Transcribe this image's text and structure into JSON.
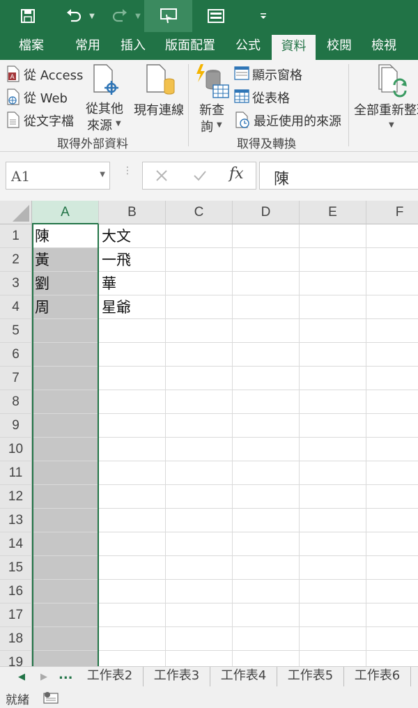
{
  "qat": {
    "save_icon": "save-icon",
    "undo_icon": "undo-icon",
    "redo_icon": "redo-icon",
    "touch_icon": "touch-mode-icon",
    "form_icon": "form-icon",
    "customize_icon": "customize-qat-icon"
  },
  "tabs": [
    "檔案",
    "常用",
    "插入",
    "版面配置",
    "公式",
    "資料",
    "校閱",
    "檢視"
  ],
  "active_tab": "資料",
  "ribbon": {
    "from_access": "從 Access",
    "from_web": "從 Web",
    "from_text": "從文字檔",
    "from_other_1": "從其他",
    "from_other_2": "來源",
    "existing_connections": "現有連線",
    "group1_label": "取得外部資料",
    "new_query_1": "新查",
    "new_query_2": "詢",
    "show_queries": "顯示窗格",
    "from_table": "從表格",
    "recent_sources": "最近使用的來源",
    "group2_label": "取得及轉換",
    "refresh_all": "全部重新整理"
  },
  "formula_bar": {
    "name_box": "A1",
    "formula": "陳"
  },
  "columns": [
    "A",
    "B",
    "C",
    "D",
    "E",
    "F"
  ],
  "selected_column": "A",
  "rows": [
    "1",
    "2",
    "3",
    "4",
    "5",
    "6",
    "7",
    "8",
    "9",
    "10",
    "11",
    "12",
    "13",
    "14",
    "15",
    "16",
    "17",
    "18",
    "19"
  ],
  "cells": [
    [
      "陳",
      "大文"
    ],
    [
      "黃",
      "一飛"
    ],
    [
      "劉",
      "華"
    ],
    [
      "周",
      "星爺"
    ]
  ],
  "sheet_tabs": [
    "工作表2",
    "工作表3",
    "工作表4",
    "工作表5",
    "工作表6"
  ],
  "sheet_nav_more": "...",
  "status": {
    "ready": "就緒"
  },
  "accent_color": "#217346"
}
